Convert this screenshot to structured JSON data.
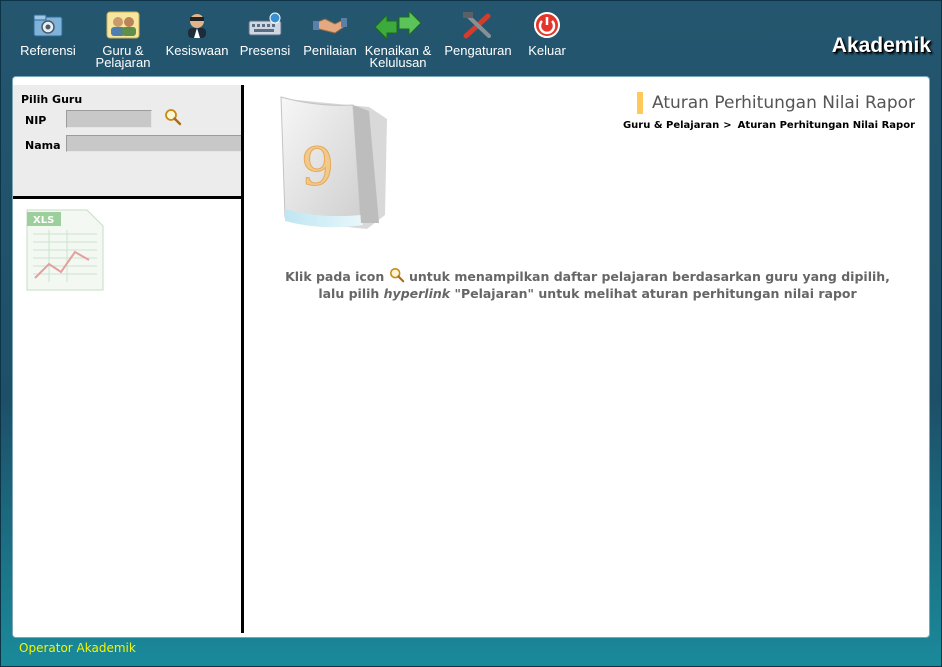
{
  "toolbar": {
    "items": [
      {
        "label": "Referensi",
        "icon": "gear-folder-icon"
      },
      {
        "label": "Guru &\nPelajaran",
        "icon": "teachers-icon"
      },
      {
        "label": "Kesiswaan",
        "icon": "student-icon"
      },
      {
        "label": "Presensi",
        "icon": "keyboard-icon"
      },
      {
        "label": "Penilaian",
        "icon": "handshake-icon"
      },
      {
        "label": "Kenaikan &\nKelulusan",
        "icon": "green-arrows-icon"
      },
      {
        "label": "Pengaturan",
        "icon": "tools-icon"
      },
      {
        "label": "Keluar",
        "icon": "power-icon"
      }
    ],
    "brand": "Akademik"
  },
  "sidebar": {
    "title": "Pilih Guru",
    "nip_label": "NIP",
    "nama_label": "Nama",
    "nip_value": "",
    "nama_value": ""
  },
  "content": {
    "page_title": "Aturan Perhitungan Nilai Rapor",
    "breadcrumb": [
      "Guru & Pelajaran",
      "Aturan Perhitungan Nilai Rapor"
    ],
    "breadcrumb_sep": ">",
    "info_part1": "Klik pada icon",
    "info_part2": "untuk menampilkan daftar pelajaran berdasarkan guru yang dipilih,",
    "info_part3": "lalu pilih",
    "info_hyperlink": "hyperlink",
    "info_part4": "\"Pelajaran\" untuk melihat aturan perhitungan nilai rapor",
    "folder_number": "9"
  },
  "footer": {
    "user": "Operator Akademik"
  },
  "colors": {
    "accent": "#ffc95a",
    "footer_text": "#f5f500",
    "header_bg": "#24566f"
  }
}
